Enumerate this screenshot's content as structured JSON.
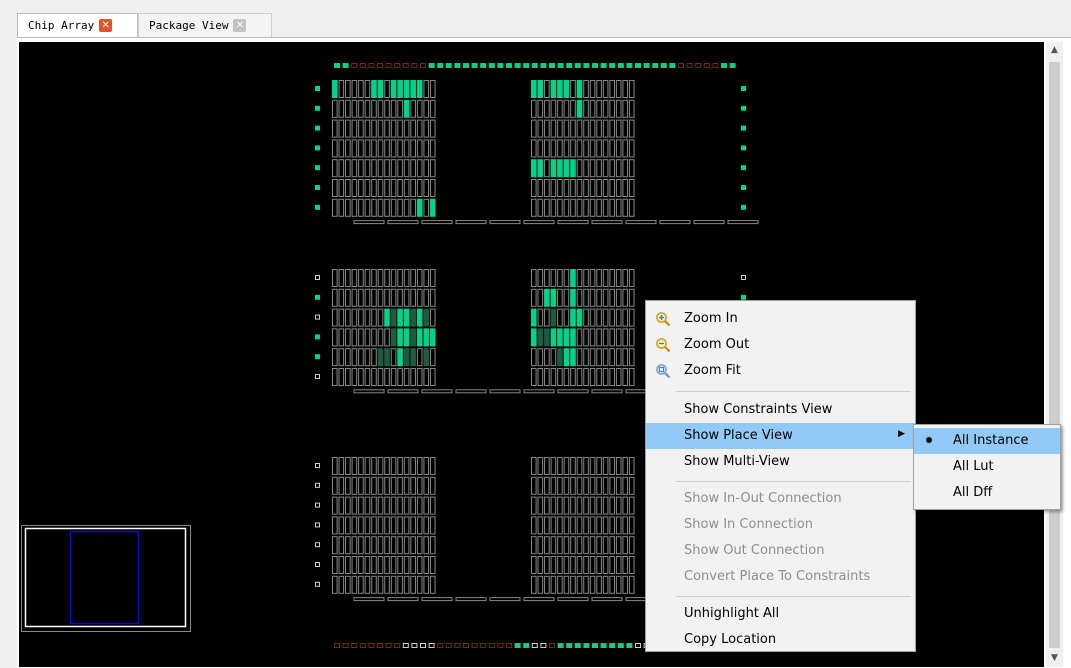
{
  "tabs": [
    {
      "label": "Chip Array",
      "close_icon": "close-active-icon"
    },
    {
      "label": "Package View",
      "close_icon": "close-inactive-icon"
    }
  ],
  "colors": {
    "canvas_bg": "#000000",
    "cell_outline": "#888888",
    "placed_cell": "#00d28a",
    "highlighted_dim": "#1f5a43",
    "unused_pad": "#8b1a1a",
    "used_pad": "#00d28a",
    "minimap_border": "#ffffff",
    "minimap_view": "#0000ff",
    "menu_highlight": "#91c9f7"
  },
  "context_menu": {
    "items": [
      {
        "label": "Zoom In",
        "icon": "zoom-in-icon",
        "enabled": true
      },
      {
        "label": "Zoom Out",
        "icon": "zoom-out-icon",
        "enabled": true
      },
      {
        "label": "Zoom Fit",
        "icon": "zoom-fit-icon",
        "enabled": true
      },
      {
        "label": "Show Constraints View",
        "enabled": true
      },
      {
        "label": "Show Place View",
        "enabled": true,
        "highlighted": true,
        "has_submenu": true
      },
      {
        "label": "Show Multi-View",
        "enabled": true
      },
      {
        "label": "Show In-Out Connection",
        "enabled": false
      },
      {
        "label": "Show In Connection",
        "enabled": false
      },
      {
        "label": "Show Out Connection",
        "enabled": false
      },
      {
        "label": "Convert Place To Constraints",
        "enabled": false
      },
      {
        "label": "Unhighlight All",
        "enabled": true
      },
      {
        "label": "Copy Location",
        "enabled": true
      }
    ]
  },
  "submenu": {
    "items": [
      {
        "label": "All Instance",
        "selected": true
      },
      {
        "label": "All Lut",
        "selected": false
      },
      {
        "label": "All Dff",
        "selected": false
      }
    ]
  },
  "chip": {
    "regions": 3,
    "rows_per_region": [
      7,
      6,
      7
    ],
    "columns_per_half": 16,
    "placed_cells": [
      [
        0,
        0,
        0
      ],
      [
        0,
        0,
        6
      ],
      [
        0,
        0,
        7
      ],
      [
        0,
        0,
        9
      ],
      [
        0,
        0,
        10
      ],
      [
        0,
        0,
        11
      ],
      [
        0,
        0,
        12
      ],
      [
        0,
        0,
        13
      ],
      [
        0,
        0,
        16
      ],
      [
        0,
        0,
        17
      ],
      [
        0,
        0,
        19
      ],
      [
        0,
        0,
        20
      ],
      [
        0,
        0,
        21
      ],
      [
        0,
        0,
        23
      ],
      [
        0,
        1,
        11
      ],
      [
        0,
        1,
        23
      ],
      [
        0,
        4,
        16
      ],
      [
        0,
        4,
        17
      ],
      [
        0,
        4,
        19
      ],
      [
        0,
        4,
        20
      ],
      [
        0,
        4,
        21
      ],
      [
        0,
        4,
        22
      ],
      [
        0,
        6,
        13
      ],
      [
        0,
        6,
        15
      ],
      [
        1,
        0,
        22
      ],
      [
        1,
        1,
        18
      ],
      [
        1,
        1,
        19
      ],
      [
        1,
        1,
        22
      ],
      [
        1,
        2,
        8
      ],
      [
        1,
        2,
        9
      ],
      [
        1,
        2,
        10
      ],
      [
        1,
        2,
        11
      ],
      [
        1,
        2,
        12
      ],
      [
        1,
        2,
        13
      ],
      [
        1,
        2,
        14
      ],
      [
        1,
        2,
        16
      ],
      [
        1,
        2,
        19
      ],
      [
        1,
        2,
        22
      ],
      [
        1,
        2,
        23
      ],
      [
        1,
        3,
        9
      ],
      [
        1,
        3,
        10
      ],
      [
        1,
        3,
        11
      ],
      [
        1,
        3,
        12
      ],
      [
        1,
        3,
        13
      ],
      [
        1,
        3,
        14
      ],
      [
        1,
        3,
        15
      ],
      [
        1,
        3,
        16
      ],
      [
        1,
        3,
        17
      ],
      [
        1,
        3,
        18
      ],
      [
        1,
        3,
        19
      ],
      [
        1,
        3,
        20
      ],
      [
        1,
        3,
        21
      ],
      [
        1,
        3,
        22
      ],
      [
        1,
        4,
        7
      ],
      [
        1,
        4,
        8
      ],
      [
        1,
        4,
        10
      ],
      [
        1,
        4,
        11
      ],
      [
        1,
        4,
        12
      ],
      [
        1,
        4,
        14
      ],
      [
        1,
        4,
        20
      ],
      [
        1,
        4,
        21
      ],
      [
        1,
        4,
        22
      ]
    ],
    "dim_cells": [
      [
        1,
        2,
        9
      ],
      [
        1,
        2,
        12
      ],
      [
        1,
        2,
        14
      ],
      [
        1,
        2,
        19
      ],
      [
        1,
        2,
        21
      ],
      [
        1,
        3,
        9
      ],
      [
        1,
        3,
        12
      ],
      [
        1,
        3,
        17
      ],
      [
        1,
        3,
        18
      ],
      [
        1,
        4,
        7
      ],
      [
        1,
        4,
        8
      ],
      [
        1,
        4,
        11
      ],
      [
        1,
        4,
        12
      ],
      [
        1,
        4,
        14
      ],
      [
        1,
        4,
        20
      ]
    ],
    "top_pads": [
      "u",
      "u",
      "r",
      "r",
      "r",
      "r",
      "r",
      "r",
      "r",
      "r",
      "r",
      "u",
      "u",
      "u",
      "u",
      "u",
      "u",
      "u",
      "u",
      "u",
      "u",
      "u",
      "u",
      "u",
      "u",
      "u",
      "u",
      "u",
      "u",
      "u",
      "u",
      "u",
      "u",
      "u",
      "u",
      "u",
      "u",
      "u",
      "u",
      "u",
      "r",
      "r",
      "r",
      "r",
      "r",
      "u",
      "u"
    ],
    "bottom_pads": [
      "r",
      "r",
      "r",
      "r",
      "r",
      "r",
      "r",
      "r",
      "o",
      "o",
      "o",
      "o",
      "r",
      "r",
      "r",
      "r",
      "r",
      "r",
      "r",
      "r",
      "r",
      "u",
      "u",
      "o",
      "o",
      "r",
      "u",
      "u",
      "u",
      "u",
      "u",
      "u",
      "u",
      "u",
      "u",
      "o",
      "o",
      "o",
      "o",
      "o",
      "o",
      "o",
      "o",
      "o",
      "o",
      "o",
      "o"
    ],
    "left_pads_region": [
      [
        "u",
        "u",
        "u",
        "u",
        "u",
        "u",
        "u"
      ],
      [
        "o",
        "u",
        "o",
        "u",
        "u",
        "o",
        "o"
      ],
      [
        "o",
        "o",
        "o",
        "o",
        "o",
        "o",
        "o"
      ]
    ]
  }
}
